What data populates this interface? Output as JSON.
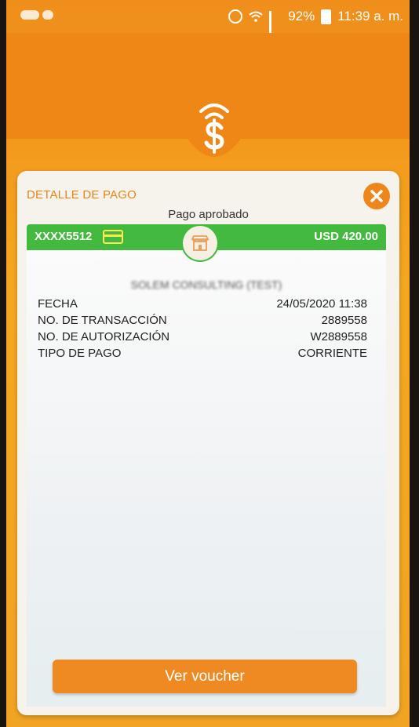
{
  "status_bar": {
    "battery": "92%",
    "time": "11:39 a. m."
  },
  "icons": {
    "alarm": "alarm-icon",
    "wifi": "wifi-icon",
    "signal": "signal-icon",
    "battery": "battery-icon",
    "logo": "wireless-dollar-icon",
    "close": "close-icon",
    "card": "credit-card-icon",
    "store": "store-icon"
  },
  "colors": {
    "orange": "#ef861c",
    "green": "#43b93f",
    "card_icon": "#ffe94a"
  },
  "detail": {
    "title": "DETALLE DE PAGO",
    "subtitle": "Pago aprobado",
    "account": "XXXX5512",
    "amount": "USD 420.00",
    "merchant": "SOLEM CONSULTING (TEST)",
    "rows": [
      {
        "label": "FECHA",
        "value": "24/05/2020 11:38"
      },
      {
        "label": "NO. DE TRANSACCIÓN",
        "value": "2889558"
      },
      {
        "label": "NO. DE AUTORIZACIÓN",
        "value": "W2889558"
      },
      {
        "label": "TIPO DE PAGO",
        "value": "CORRIENTE"
      }
    ],
    "voucher_button": "Ver voucher"
  }
}
